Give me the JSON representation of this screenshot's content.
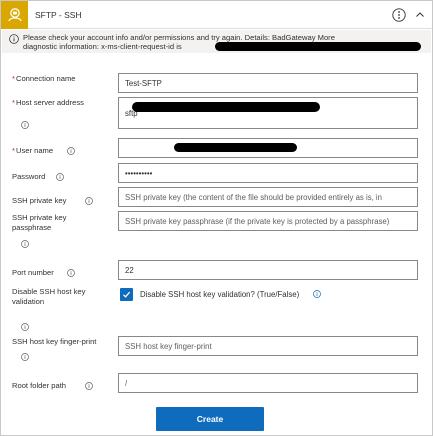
{
  "header": {
    "title": "SFTP - SSH",
    "more_icon": "more-options-icon",
    "collapse_icon": "collapse-icon",
    "logo_icon": "sftp-connector-icon",
    "logo_color": "#d9a700"
  },
  "error": {
    "icon": "info-circle-icon",
    "line1": "Please check your account info and/or permissions and try again. Details: BadGateway More",
    "line2": "diagnostic information: x-ms-client-request-id is"
  },
  "form": {
    "connection_name": {
      "label": "Connection name",
      "required": "*",
      "value": "Test-SFTP"
    },
    "host_server_address": {
      "label": "Host server address",
      "required": "*",
      "value": "sftp"
    },
    "user_name": {
      "label": "User name",
      "required": "*",
      "value": ""
    },
    "password": {
      "label": "Password",
      "value": "••••••••••"
    },
    "ssh_private_key": {
      "label": "SSH private key",
      "placeholder": "SSH private key (the content of the file should be provided entirely as is, in"
    },
    "ssh_private_key_passphrase": {
      "label_line1": "SSH private key",
      "label_line2": "passphrase",
      "placeholder": "SSH private key passphrase (if the private key is protected by a passphrase)"
    },
    "port_number": {
      "label": "Port number",
      "value": "22"
    },
    "disable_host_key_validation": {
      "label_line1": "Disable SSH host key",
      "label_line2": "validation",
      "checkbox_label": "Disable SSH host key validation? (True/False)",
      "checked": true
    },
    "host_key_fingerprint": {
      "label": "SSH host key finger-print",
      "placeholder": "SSH host key finger-print"
    },
    "root_folder_path": {
      "label": "Root folder path",
      "placeholder": "/"
    }
  },
  "actions": {
    "create_label": "Create"
  },
  "colors": {
    "accent": "#0f6cbd",
    "required": "#a4262c",
    "error_bg": "#f3f2f1"
  }
}
